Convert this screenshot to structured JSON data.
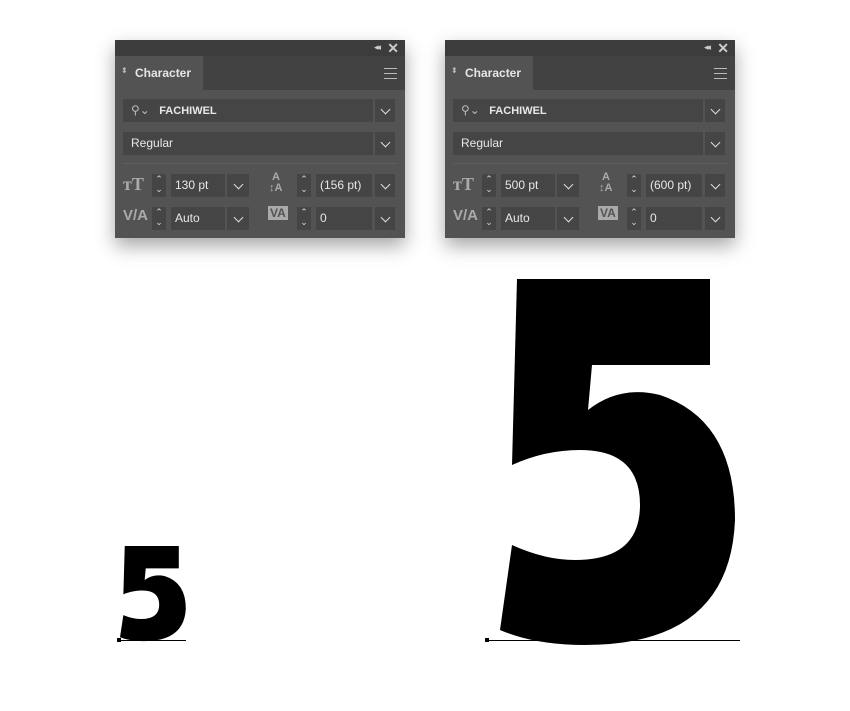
{
  "panels": [
    {
      "title": "Character",
      "font_family": "FACHIWEL",
      "font_style": "Regular",
      "font_size": "130 pt",
      "leading": "(156 pt)",
      "kerning": "Auto",
      "tracking": "0"
    },
    {
      "title": "Character",
      "font_family": "FACHIWEL",
      "font_style": "Regular",
      "font_size": "500 pt",
      "leading": "(600 pt)",
      "kerning": "Auto",
      "tracking": "0"
    }
  ],
  "glyphs": {
    "small": "5",
    "large": "5"
  },
  "colors": {
    "panel": "#535353",
    "field": "#454545",
    "glyph": "#000000"
  }
}
